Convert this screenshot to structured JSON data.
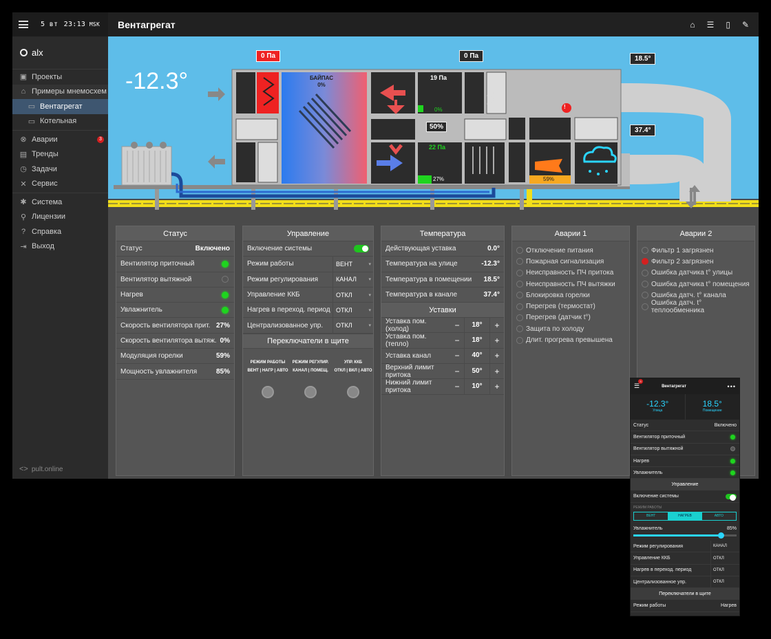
{
  "topbar": {
    "date": "5 вт",
    "time": "23:13",
    "tz": "MSK"
  },
  "user": {
    "name": "alx"
  },
  "sidebar": {
    "items": [
      {
        "label": "Проекты",
        "icon": "briefcase-icon"
      },
      {
        "label": "Примеры мнемосхем",
        "icon": "home-icon"
      },
      {
        "label": "Вентагрегат",
        "icon": "monitor-icon"
      },
      {
        "label": "Котельная",
        "icon": "monitor-icon"
      },
      {
        "label": "Аварии",
        "icon": "error-icon",
        "badge": "3"
      },
      {
        "label": "Тренды",
        "icon": "chart-icon"
      },
      {
        "label": "Задачи",
        "icon": "alarm-clock-icon"
      },
      {
        "label": "Сервис",
        "icon": "tools-icon"
      },
      {
        "label": "Система",
        "icon": "gear-icon"
      },
      {
        "label": "Лицензии",
        "icon": "key-icon"
      },
      {
        "label": "Справка",
        "icon": "help-icon"
      },
      {
        "label": "Выход",
        "icon": "logout-icon"
      }
    ],
    "footer": "pult.online"
  },
  "header": {
    "title": "Вентагрегат"
  },
  "scheme": {
    "outside_temp": "-12.3°",
    "pressure_filter": "0 Па",
    "pressure_exhaust": "0 Па",
    "bypass_label": "БАЙПАС",
    "bypass_value": "0%",
    "fan_exhaust_pa": "19 Па",
    "fan_exhaust_pct": "0%",
    "damper_pct": "50%",
    "fan_supply_pa": "22 Па",
    "fan_supply_pct": "27%",
    "burner_pct": "59%",
    "temp_room": "18.5°",
    "temp_channel": "37.4°",
    "alarm_marker": "!"
  },
  "status": {
    "title": "Статус",
    "rows": [
      {
        "label": "Статус",
        "value": "Включено"
      },
      {
        "label": "Вентилятор приточный",
        "dot": "on"
      },
      {
        "label": "Вентилятор вытяжной",
        "dot": "off"
      },
      {
        "label": "Нагрев",
        "dot": "on"
      },
      {
        "label": "Увлажнитель",
        "dot": "on"
      },
      {
        "label": "Скорость вентилятора прит.",
        "value": "27%"
      },
      {
        "label": "Скорость вентилятора вытяж.",
        "value": "0%"
      },
      {
        "label": "Модуляция горелки",
        "value": "59%"
      },
      {
        "label": "Мощность увлажнителя",
        "value": "85%"
      }
    ]
  },
  "control": {
    "title": "Управление",
    "enable_label": "Включение системы",
    "rows": [
      {
        "label": "Режим работы",
        "value": "ВЕНТ"
      },
      {
        "label": "Режим регулирования",
        "value": "КАНАЛ"
      },
      {
        "label": "Управление ККБ",
        "value": "ОТКЛ"
      },
      {
        "label": "Нагрев в переход. период",
        "value": "ОТКЛ"
      },
      {
        "label": "Централизованное упр.",
        "value": "ОТКЛ"
      }
    ],
    "switch_title": "Переключатели в щите",
    "switches": [
      {
        "line1": "РЕЖИМ РАБОТЫ",
        "line2": "ВЕНТ | НАГР | АВТО"
      },
      {
        "line1": "РЕЖИМ РЕГУЛИР.",
        "line2": "КАНАЛ | ПОМЕЩ."
      },
      {
        "line1": "УПР. ККБ",
        "line2": "ОТКЛ | ВКЛ | АВТО"
      }
    ]
  },
  "temperature": {
    "title": "Температура",
    "rows": [
      {
        "label": "Действующая уставка",
        "value": "0.0°"
      },
      {
        "label": "Температура на улице",
        "value": "-12.3°"
      },
      {
        "label": "Температура в помещении",
        "value": "18.5°"
      },
      {
        "label": "Температура в канале",
        "value": "37.4°"
      }
    ],
    "setpoints_title": "Уставки",
    "setpoints": [
      {
        "label": "Уставка пом. (холод)",
        "value": "18°"
      },
      {
        "label": "Уставка пом. (тепло)",
        "value": "18°"
      },
      {
        "label": "Уставка канал",
        "value": "40°"
      },
      {
        "label": "Верхний лимит притока",
        "value": "50°"
      },
      {
        "label": "Нижний лимит притока",
        "value": "10°"
      }
    ]
  },
  "alarms1": {
    "title": "Аварии 1",
    "items": [
      "Отключение питания",
      "Пожарная сигнализация",
      "Неисправность ПЧ притока",
      "Неисправность ПЧ вытяжки",
      "Блокировка горелки",
      "Перегрев (термостат)",
      "Перегрев (датчик t°)",
      "Защита по холоду",
      "Длит. прогрева превышена"
    ]
  },
  "alarms2": {
    "title": "Аварии 2",
    "items": [
      {
        "label": "Фильтр 1 загрязнен",
        "active": false
      },
      {
        "label": "Фильтр 2 загрязнен",
        "active": true
      },
      {
        "label": "Ошибка датчика t° улицы",
        "active": false
      },
      {
        "label": "Ошибка датчика t° помещения",
        "active": false
      },
      {
        "label": "Ошибка датч. t° канала",
        "active": false
      },
      {
        "label": "Ошибка датч. t° теплообменника",
        "active": false
      }
    ]
  },
  "phone": {
    "title": "Вентагрегат",
    "menu": "•••",
    "badge": "3",
    "street_value": "-12.3°",
    "street_label": "Улица",
    "room_value": "18.5°",
    "room_label": "Помещение",
    "status_label": "Статус",
    "status_value": "Включено",
    "rows": [
      {
        "label": "Вентилятор приточный",
        "dot": "on"
      },
      {
        "label": "Вентилятор вытяжной",
        "dot": "off"
      },
      {
        "label": "Нагрев",
        "dot": "on"
      },
      {
        "label": "Увлажнитель",
        "dot": "on"
      }
    ],
    "control_title": "Управление",
    "enable_label": "Включение системы",
    "mode_label": "Режим работы",
    "modes": [
      "ВЕНТ",
      "НАГРЕВ",
      "АВТО"
    ],
    "humid_label": "Увлажнитель",
    "humid_value": "85%",
    "humid_level": 0.85,
    "selects": [
      {
        "label": "Режим регулирования",
        "value": "КАНАЛ"
      },
      {
        "label": "Управление ККБ",
        "value": "ОТКЛ"
      },
      {
        "label": "Нагрев в переход. период",
        "value": "ОТКЛ"
      },
      {
        "label": "Централизованное упр.",
        "value": "ОТКЛ"
      }
    ],
    "switch_title": "Переключатели в щите",
    "last_label": "Режим работы",
    "last_value": "Нагрев"
  }
}
